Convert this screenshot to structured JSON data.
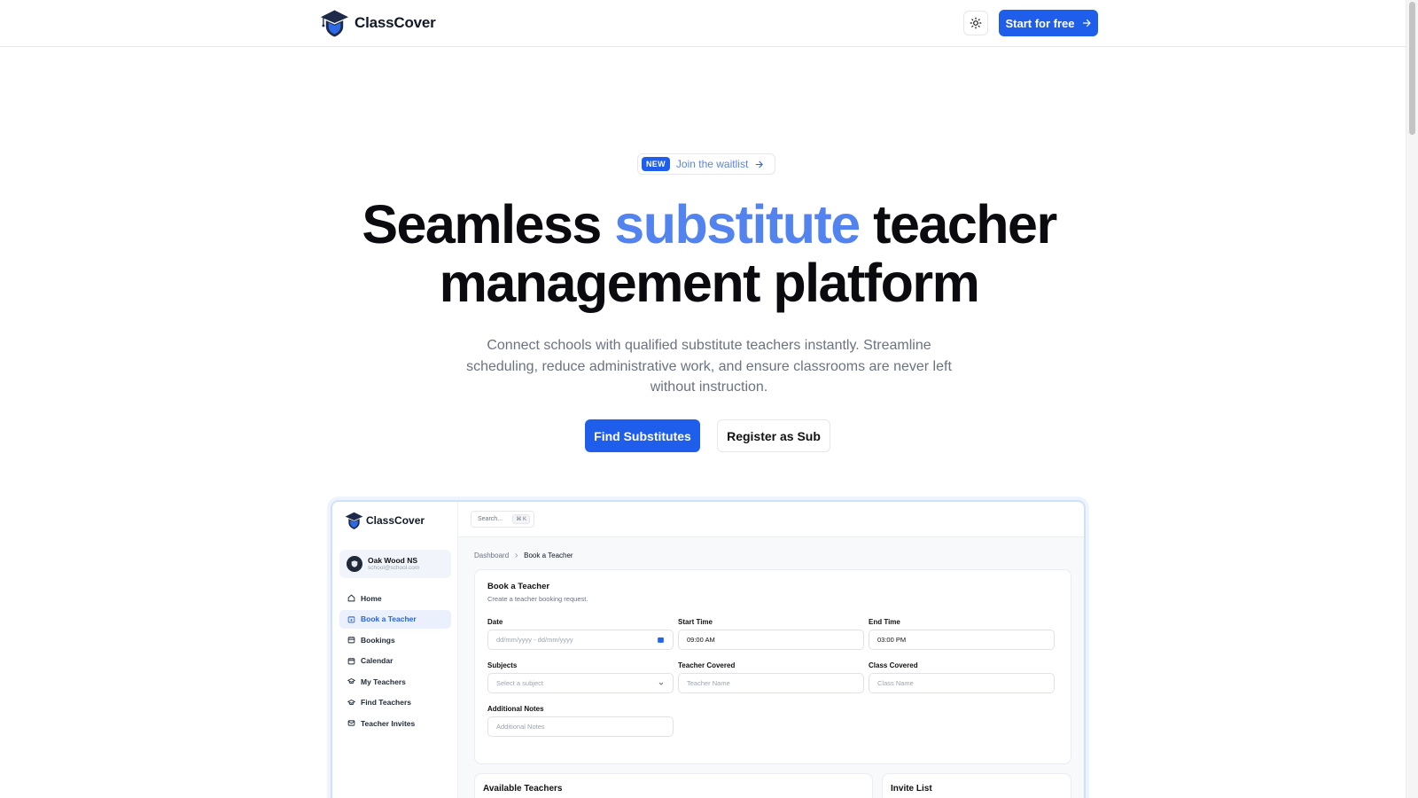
{
  "nav": {
    "brand": "ClassCover",
    "cta_label": "Start for free"
  },
  "hero": {
    "badge_new": "NEW",
    "badge_text": "Join the waitlist",
    "title_part1": "Seamless",
    "title_accent": "substitute",
    "title_part2": "teacher",
    "title_line2": "management platform",
    "subtitle": "Connect schools with qualified substitute teachers instantly. Streamline scheduling, reduce administrative work, and ensure classrooms are never left without instruction.",
    "primary_button": "Find Substitutes",
    "secondary_button": "Register as Sub"
  },
  "preview": {
    "brand": "ClassCover",
    "search_placeholder": "Search...",
    "search_shortcut": "⌘ K",
    "user": {
      "name": "Oak Wood NS",
      "email": "school@school.com"
    },
    "nav_items": [
      {
        "label": "Home",
        "icon": "home-icon"
      },
      {
        "label": "Book a Teacher",
        "icon": "calendar-plus-icon",
        "active": true
      },
      {
        "label": "Bookings",
        "icon": "bookings-icon"
      },
      {
        "label": "Calendar",
        "icon": "calendar-icon"
      },
      {
        "label": "My Teachers",
        "icon": "graduation-cap-icon"
      },
      {
        "label": "Find Teachers",
        "icon": "graduation-cap-icon"
      },
      {
        "label": "Teacher Invites",
        "icon": "mail-icon"
      }
    ],
    "breadcrumb": {
      "root": "Dashboard",
      "current": "Book a Teacher"
    },
    "form": {
      "title": "Book a Teacher",
      "description": "Create a teacher booking request.",
      "date_label": "Date",
      "date_value": "dd/mm/yyyy - dd/mm/yyyy",
      "start_label": "Start Time",
      "start_value": "09:00 AM",
      "end_label": "End Time",
      "end_value": "03:00 PM",
      "subjects_label": "Subjects",
      "subjects_placeholder": "Select a subject",
      "teacher_label": "Teacher Covered",
      "teacher_placeholder": "Teacher Name",
      "class_label": "Class Covered",
      "class_placeholder": "Class Name",
      "notes_label": "Additional Notes",
      "notes_placeholder": "Additional Notes"
    },
    "available_title": "Available Teachers",
    "invite_title": "Invite List"
  },
  "colors": {
    "accent": "#1f5eea",
    "title_accent": "#5383ee",
    "logo_dark": "#1e2a4a",
    "logo_blue": "#2f6ae6"
  }
}
